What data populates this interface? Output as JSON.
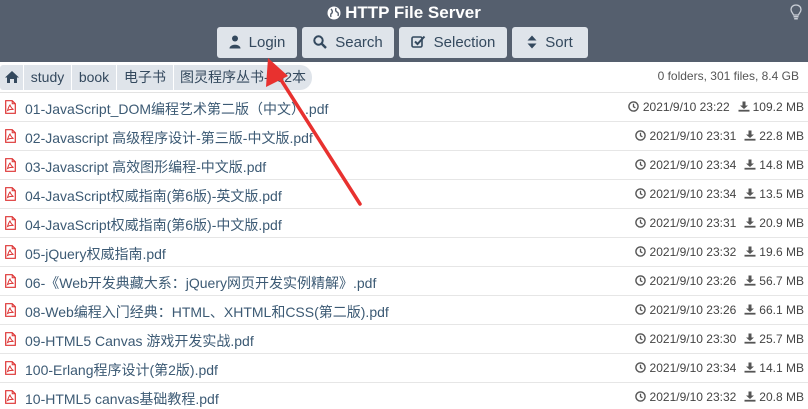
{
  "app": {
    "title": "HTTP File Server"
  },
  "toolbar": {
    "login_label": "Login",
    "search_label": "Search",
    "selection_label": "Selection",
    "sort_label": "Sort"
  },
  "breadcrumb": [
    "study",
    "book",
    "电子书",
    "图灵程序丛书-302本"
  ],
  "summary": "0 folders, 301 files, 8.4 GB",
  "files": [
    {
      "name": "01-JavaScript_DOM编程艺术第二版（中文）.pdf",
      "date": "2021/9/10 23:22",
      "size": "109.2 MB"
    },
    {
      "name": "02-Javascript 高级程序设计-第三版-中文版.pdf",
      "date": "2021/9/10 23:31",
      "size": "22.8 MB"
    },
    {
      "name": "03-Javascript 高效图形编程-中文版.pdf",
      "date": "2021/9/10 23:34",
      "size": "14.8 MB"
    },
    {
      "name": "04-JavaScript权威指南(第6版)-英文版.pdf",
      "date": "2021/9/10 23:34",
      "size": "13.5 MB"
    },
    {
      "name": "04-JavaScript权威指南(第6版)-中文版.pdf",
      "date": "2021/9/10 23:31",
      "size": "20.9 MB"
    },
    {
      "name": "05-jQuery权威指南.pdf",
      "date": "2021/9/10 23:32",
      "size": "19.6 MB"
    },
    {
      "name": "06-《Web开发典藏大系：jQuery网页开发实例精解》.pdf",
      "date": "2021/9/10 23:26",
      "size": "56.7 MB"
    },
    {
      "name": "08-Web编程入门经典：HTML、XHTML和CSS(第二版).pdf",
      "date": "2021/9/10 23:26",
      "size": "66.1 MB"
    },
    {
      "name": "09-HTML5 Canvas 游戏开发实战.pdf",
      "date": "2021/9/10 23:30",
      "size": "25.7 MB"
    },
    {
      "name": "100-Erlang程序设计(第2版).pdf",
      "date": "2021/9/10 23:34",
      "size": "14.1 MB"
    },
    {
      "name": "10-HTML5 canvas基础教程.pdf",
      "date": "2021/9/10 23:32",
      "size": "20.8 MB"
    }
  ],
  "colors": {
    "header_bg": "#555f6e",
    "button_bg": "#dfe4ea",
    "annotation_arrow": "#e8312f"
  },
  "icons": [
    "globe-icon",
    "lightbulb-icon",
    "user-icon",
    "search-icon",
    "checkbox-icon",
    "sort-icon",
    "home-icon",
    "pdf-file-icon",
    "clock-icon",
    "download-icon"
  ]
}
